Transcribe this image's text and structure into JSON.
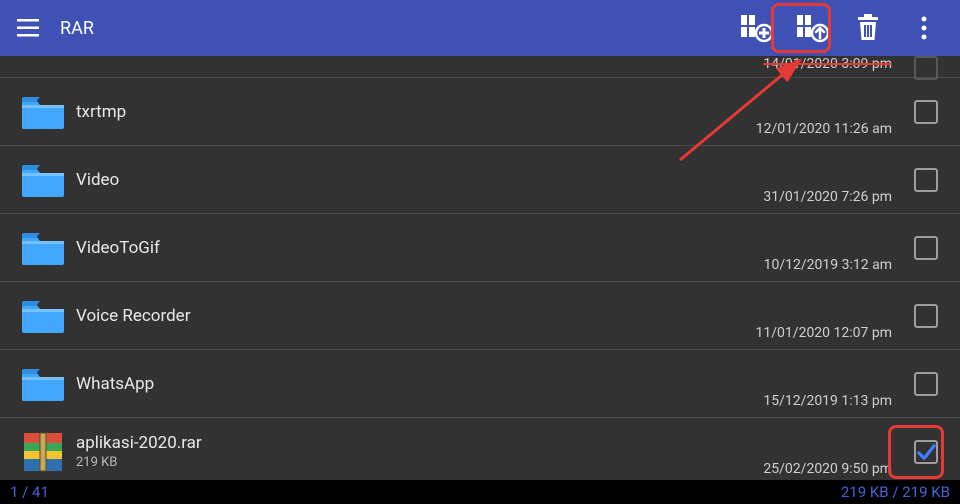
{
  "app": {
    "title": "RAR"
  },
  "toolbar": {
    "menu": "menu",
    "archive_add": "archive-add",
    "archive_extract": "archive-extract",
    "delete": "delete",
    "overflow": "more"
  },
  "partial_row": {
    "date": "14/01/2020 3:09 pm"
  },
  "rows": [
    {
      "name": "txrtmp",
      "date": "12/01/2020 11:26 am",
      "type": "folder",
      "checked": false
    },
    {
      "name": "Video",
      "date": "31/01/2020 7:26 pm",
      "type": "folder",
      "checked": false
    },
    {
      "name": "VideoToGif",
      "date": "10/12/2019 3:12 am",
      "type": "folder",
      "checked": false
    },
    {
      "name": "Voice Recorder",
      "date": "11/01/2020 12:07 pm",
      "type": "folder",
      "checked": false
    },
    {
      "name": "WhatsApp",
      "date": "15/12/2019 1:13 pm",
      "type": "folder",
      "checked": false
    },
    {
      "name": "aplikasi-2020.rar",
      "date": "25/02/2020 9:50 pm",
      "type": "rar",
      "size": "219 KB",
      "checked": true
    }
  ],
  "footer": {
    "count": "1 / 41",
    "size": "219 KB / 219 KB"
  }
}
